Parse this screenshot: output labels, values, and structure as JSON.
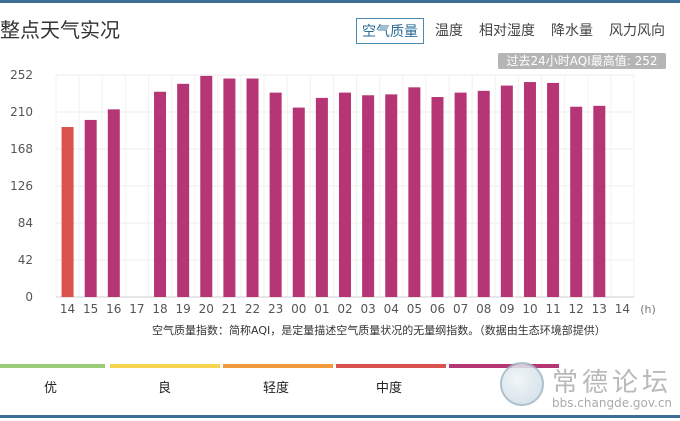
{
  "header": {
    "title": "整点天气实况",
    "tabs": [
      {
        "label": "空气质量",
        "active": true
      },
      {
        "label": "温度",
        "active": false
      },
      {
        "label": "相对湿度",
        "active": false
      },
      {
        "label": "降水量",
        "active": false
      },
      {
        "label": "风力风向",
        "active": false
      }
    ]
  },
  "max_badge": "过去24小时AQI最高值: 252",
  "note": "空气质量指数：简称AQI，是定量描述空气质量状况的无量纲指数。（数据由生态环境部提供）",
  "legend": [
    {
      "label": "优",
      "color": "#9ccb78"
    },
    {
      "label": "良",
      "color": "#f6d54e"
    },
    {
      "label": "轻度",
      "color": "#f09a3d"
    },
    {
      "label": "中度",
      "color": "#d9534f"
    },
    {
      "label": "",
      "color": "#b63574"
    }
  ],
  "watermark": {
    "text": "常德论坛",
    "url": "bbs.changde.gov.cn"
  },
  "chart_data": {
    "type": "bar",
    "categories": [
      "14",
      "15",
      "16",
      "17",
      "18",
      "19",
      "20",
      "21",
      "22",
      "23",
      "00",
      "01",
      "02",
      "03",
      "04",
      "05",
      "06",
      "07",
      "08",
      "09",
      "10",
      "11",
      "12",
      "13",
      "14"
    ],
    "values": [
      193,
      201,
      213,
      null,
      233,
      242,
      251,
      248,
      248,
      232,
      215,
      226,
      232,
      229,
      230,
      238,
      227,
      232,
      234,
      240,
      244,
      243,
      216,
      217,
      null
    ],
    "bar_colors": [
      "#d9534f",
      "#b63574",
      "#b63574",
      null,
      "#b63574",
      "#b63574",
      "#b63574",
      "#b63574",
      "#b63574",
      "#b63574",
      "#b63574",
      "#b63574",
      "#b63574",
      "#b63574",
      "#b63574",
      "#b63574",
      "#b63574",
      "#b63574",
      "#b63574",
      "#b63574",
      "#b63574",
      "#b63574",
      "#b63574",
      "#b63574",
      null
    ],
    "yticks": [
      0,
      42,
      84,
      126,
      168,
      210,
      252
    ],
    "ylim": [
      0,
      252
    ],
    "x_unit": "(h)",
    "grid": true
  }
}
